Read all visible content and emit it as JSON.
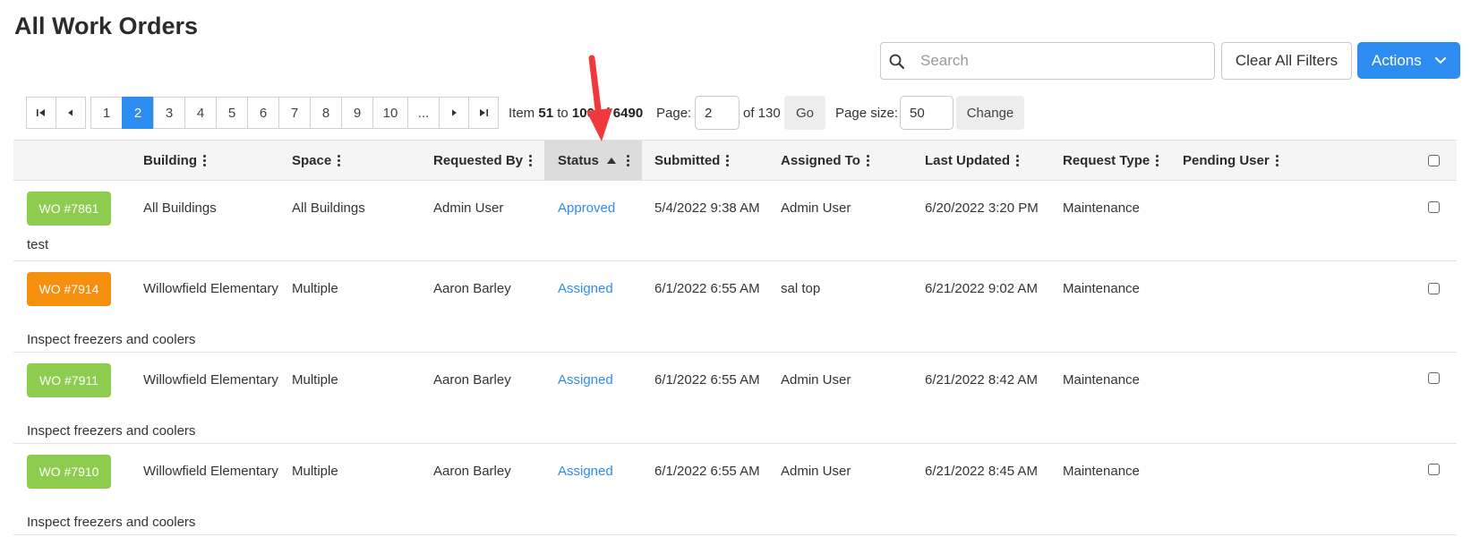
{
  "page": {
    "title": "All Work Orders"
  },
  "search": {
    "placeholder": "Search"
  },
  "toolbar": {
    "clear_label": "Clear All Filters",
    "actions_label": "Actions"
  },
  "pagination": {
    "pages": [
      "1",
      "2",
      "3",
      "4",
      "5",
      "6",
      "7",
      "8",
      "9",
      "10",
      "..."
    ],
    "current_page": "2",
    "item_prefix": "Item",
    "item_from": "51",
    "item_to_word": "to",
    "item_to": "100",
    "item_of_word": "of",
    "item_total": "6490",
    "page_label": "Page:",
    "page_value": "2",
    "page_of": "of 130",
    "go_label": "Go",
    "size_label": "Page size:",
    "size_value": "50",
    "change_label": "Change"
  },
  "table": {
    "columns": [
      "Building",
      "Space",
      "Requested By",
      "Status",
      "Submitted",
      "Assigned To",
      "Last Updated",
      "Request Type",
      "Pending User"
    ],
    "sorted_column": "Status",
    "sort_direction": "ascending",
    "rows": [
      {
        "wo": "WO #7861",
        "wo_color": "#8dcc4e",
        "building": "All Buildings",
        "space": "All Buildings",
        "requested_by": "Admin User",
        "status": "Approved",
        "submitted": "5/4/2022 9:38 AM",
        "assigned_to": "Admin User",
        "last_updated": "6/20/2022 3:20 PM",
        "request_type": "Maintenance",
        "pending_user": "",
        "description": "test"
      },
      {
        "wo": "WO #7914",
        "wo_color": "#f5900f",
        "building": "Willowfield Elementary",
        "space": "Multiple",
        "requested_by": "Aaron Barley",
        "status": "Assigned",
        "submitted": "6/1/2022 6:55 AM",
        "assigned_to": "sal top",
        "last_updated": "6/21/2022 9:02 AM",
        "request_type": "Maintenance",
        "pending_user": "",
        "description": "Inspect freezers and coolers"
      },
      {
        "wo": "WO #7911",
        "wo_color": "#8dcc4e",
        "building": "Willowfield Elementary",
        "space": "Multiple",
        "requested_by": "Aaron Barley",
        "status": "Assigned",
        "submitted": "6/1/2022 6:55 AM",
        "assigned_to": "Admin User",
        "last_updated": "6/21/2022 8:42 AM",
        "request_type": "Maintenance",
        "pending_user": "",
        "description": "Inspect freezers and coolers"
      },
      {
        "wo": "WO #7910",
        "wo_color": "#8dcc4e",
        "building": "Willowfield Elementary",
        "space": "Multiple",
        "requested_by": "Aaron Barley",
        "status": "Assigned",
        "submitted": "6/1/2022 6:55 AM",
        "assigned_to": "Admin User",
        "last_updated": "6/21/2022 8:45 AM",
        "request_type": "Maintenance",
        "pending_user": "",
        "description": "Inspect freezers and coolers"
      }
    ]
  },
  "colors": {
    "accent": "#2d8cf0",
    "annotation_arrow": "#f0393c"
  }
}
